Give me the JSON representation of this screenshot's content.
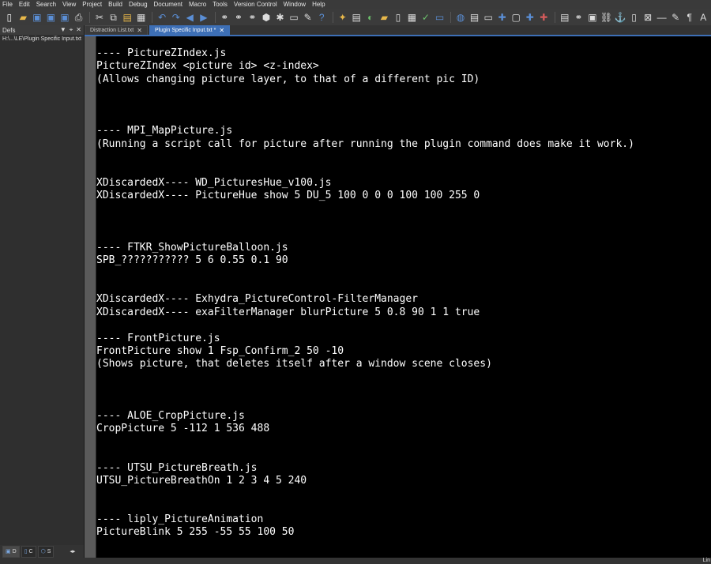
{
  "menu": [
    "File",
    "Edit",
    "Search",
    "View",
    "Project",
    "Build",
    "Debug",
    "Document",
    "Macro",
    "Tools",
    "Version Control",
    "Window",
    "Help"
  ],
  "toolbar_icons": [
    {
      "name": "new-file-icon",
      "glyph": "▯",
      "color": "#f0f0f0"
    },
    {
      "name": "open-folder-icon",
      "glyph": "▰",
      "color": "#e8b84a"
    },
    {
      "name": "save-icon",
      "glyph": "▣",
      "color": "#5b8fd6"
    },
    {
      "name": "save-all-icon",
      "glyph": "▣",
      "color": "#5b8fd6"
    },
    {
      "name": "save-as-icon",
      "glyph": "▣",
      "color": "#5b8fd6"
    },
    {
      "name": "print-icon",
      "glyph": "⎙",
      "color": "#dddddd"
    },
    {
      "name": "cut-icon",
      "glyph": "✂",
      "color": "#dddddd"
    },
    {
      "name": "copy-icon",
      "glyph": "⧉",
      "color": "#dddddd"
    },
    {
      "name": "paste-icon",
      "glyph": "▤",
      "color": "#e8b84a"
    },
    {
      "name": "select-all-icon",
      "glyph": "▦",
      "color": "#dddddd"
    },
    {
      "name": "undo-icon",
      "glyph": "↶",
      "color": "#5b8fd6"
    },
    {
      "name": "redo-icon",
      "glyph": "↷",
      "color": "#5b8fd6"
    },
    {
      "name": "back-icon",
      "glyph": "◀",
      "color": "#5b8fd6"
    },
    {
      "name": "forward-icon",
      "glyph": "▶",
      "color": "#5b8fd6"
    },
    {
      "name": "find-icon",
      "glyph": "⚭",
      "color": "#dddddd"
    },
    {
      "name": "find-next-icon",
      "glyph": "⚭",
      "color": "#dddddd"
    },
    {
      "name": "replace-icon",
      "glyph": "⚭",
      "color": "#dddddd"
    },
    {
      "name": "package-icon",
      "glyph": "⬢",
      "color": "#dddddd"
    },
    {
      "name": "bug-icon",
      "glyph": "✱",
      "color": "#dddddd"
    },
    {
      "name": "monitor-icon",
      "glyph": "▭",
      "color": "#dddddd"
    },
    {
      "name": "wrench-icon",
      "glyph": "✎",
      "color": "#dddddd"
    },
    {
      "name": "help-icon",
      "glyph": "?",
      "color": "#5b8fd6"
    },
    {
      "name": "magic-wand-icon",
      "glyph": "✦",
      "color": "#e8b84a"
    },
    {
      "name": "clipboard-icon",
      "glyph": "▤",
      "color": "#dddddd"
    },
    {
      "name": "toggle-icon",
      "glyph": "◐",
      "color": "#6ec46e"
    },
    {
      "name": "folder-icon",
      "glyph": "▰",
      "color": "#e8b84a"
    },
    {
      "name": "document-icon",
      "glyph": "▯",
      "color": "#dddddd"
    },
    {
      "name": "calculator-icon",
      "glyph": "▦",
      "color": "#dddddd"
    },
    {
      "name": "spellcheck-icon",
      "glyph": "✓",
      "color": "#6ec46e"
    },
    {
      "name": "terminal-icon",
      "glyph": "▭",
      "color": "#5b8fd6"
    },
    {
      "name": "globe-icon",
      "glyph": "◍",
      "color": "#5b8fd6"
    },
    {
      "name": "layout-icon",
      "glyph": "▤",
      "color": "#dddddd"
    },
    {
      "name": "split-icon",
      "glyph": "▭",
      "color": "#dddddd"
    },
    {
      "name": "add-icon",
      "glyph": "✚",
      "color": "#5b8fd6"
    },
    {
      "name": "window-icon",
      "glyph": "▢",
      "color": "#dddddd"
    },
    {
      "name": "add-blue-icon",
      "glyph": "✚",
      "color": "#5b8fd6"
    },
    {
      "name": "add-red-icon",
      "glyph": "✚",
      "color": "#d65b5b"
    },
    {
      "name": "notes-icon",
      "glyph": "▤",
      "color": "#dddddd"
    },
    {
      "name": "binoculars-icon",
      "glyph": "⚭",
      "color": "#dddddd"
    },
    {
      "name": "image-icon",
      "glyph": "▣",
      "color": "#dddddd"
    },
    {
      "name": "link-icon",
      "glyph": "⛓",
      "color": "#dddddd"
    },
    {
      "name": "anchor-icon",
      "glyph": "⚓",
      "color": "#dddddd"
    },
    {
      "name": "script-icon",
      "glyph": "▯",
      "color": "#dddddd"
    },
    {
      "name": "close-doc-icon",
      "glyph": "⊠",
      "color": "#dddddd"
    },
    {
      "name": "minus-icon",
      "glyph": "—",
      "color": "#dddddd"
    },
    {
      "name": "brush-icon",
      "glyph": "✎",
      "color": "#dddddd"
    },
    {
      "name": "paragraph-icon",
      "glyph": "¶",
      "color": "#dddddd"
    },
    {
      "name": "text-icon",
      "glyph": "A",
      "color": "#dddddd"
    }
  ],
  "sidebar": {
    "title": "Defs",
    "path": "H:\\...\\LE\\Plugin Specific Input.txt",
    "tabs": [
      {
        "label": "D",
        "icon": "defs-tab-icon",
        "glyph": "▣"
      },
      {
        "label": "C",
        "icon": "clips-tab-icon",
        "glyph": "▯"
      },
      {
        "label": "S",
        "icon": "scripts-tab-icon",
        "glyph": "⬡"
      }
    ]
  },
  "tabs": [
    {
      "label": "Distraction List.txt",
      "active": false
    },
    {
      "label": "Plugin Specific Input.txt *",
      "active": true
    }
  ],
  "editor": {
    "lines": [
      "---- PictureZIndex.js",
      "PictureZIndex <picture id> <z-index>",
      "(Allows changing picture layer, to that of a different pic ID)",
      "",
      "",
      "",
      "---- MPI_MapPicture.js",
      "(Running a script call for picture after running the plugin command does make it work.)",
      "",
      "",
      "XDiscardedX---- WD_PicturesHue_v100.js",
      "XDiscardedX---- PictureHue show 5 DU_5 100 0 0 0 100 100 255 0",
      "",
      "",
      "",
      "---- FTKR_ShowPictureBalloon.js",
      "SPB_??????????? 5 6 0.55 0.1 90",
      "",
      "",
      "XDiscardedX---- Exhydra_PictureControl-FilterManager",
      "XDiscardedX---- exaFilterManager blurPicture 5 0.8 90 1 1 true",
      "",
      "---- FrontPicture.js",
      "FrontPicture show 1 Fsp_Confirm_2 50 -10",
      "(Shows picture, that deletes itself after a window scene closes)",
      "",
      "",
      "",
      "---- ALOE_CropPicture.js",
      "CropPicture 5 -112 1 536 488",
      "",
      "",
      "---- UTSU_PictureBreath.js",
      "UTSU_PictureBreathOn 1 2 3 4 5 240",
      "",
      "",
      "---- liply_PictureAnimation",
      "PictureBlink 5 255 -55 55 100 50"
    ]
  },
  "status": {
    "text": "Lin"
  },
  "colors": {
    "accent": "#3d6fb6",
    "editor_bg": "#000000",
    "editor_fg": "#ffffff"
  }
}
